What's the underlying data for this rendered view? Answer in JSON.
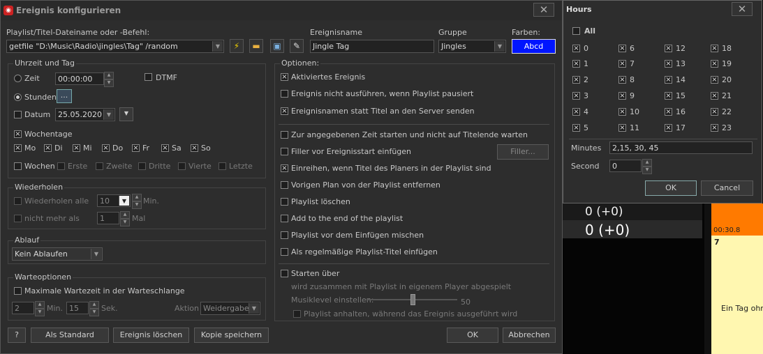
{
  "dialog": {
    "title": "Ereignis konfigurieren",
    "close": "✕",
    "playlist_label": "Playlist/Titel-Dateiname oder -Befehl:",
    "playlist_value": "getfile \"D:\\Music\\Radio\\jingles\\Tag\" /random",
    "eventname_label": "Ereignisname",
    "eventname_value": "Jingle Tag",
    "group_label": "Gruppe",
    "group_value": "Jingles",
    "colors_label": "Farben:",
    "color_value": "Abcd"
  },
  "time": {
    "group_label": "Uhrzeit und Tag",
    "zeit_label": "Zeit",
    "zeit_value": "00:00:00",
    "dtmf_label": "DTMF",
    "stunden_label": "Stunden",
    "stunden_button": "...",
    "datum_label": "Datum",
    "datum_value": "25.05.2020",
    "wochentage_label": "Wochentage",
    "days": [
      "Mo",
      "Di",
      "Mi",
      "Do",
      "Fr",
      "Sa",
      "So"
    ],
    "wochen_label": "Wochen",
    "weeks": [
      "Erste",
      "Zweite",
      "Dritte",
      "Vierte",
      "Letzte"
    ]
  },
  "repeat": {
    "group_label": "Wiederholen",
    "every_label": "Wiederholen alle",
    "every_value": "10",
    "min_label": "Min.",
    "max_label": "nicht mehr als",
    "max_value": "1",
    "mal_label": "Mal"
  },
  "expire": {
    "group_label": "Ablauf",
    "value": "Kein Ablaufen"
  },
  "wait": {
    "group_label": "Warteoptionen",
    "max_label": "Maximale Wartezeit in der Warteschlange",
    "min_value": "2",
    "min_label": "Min.",
    "sec_value": "15",
    "sec_label": "Sek.",
    "action_label": "Aktion",
    "action_value": "Weidergabe"
  },
  "options": {
    "group_label": "Optionen:",
    "items": [
      {
        "label": "Aktiviertes Ereignis",
        "checked": true
      },
      {
        "label": "Ereignis nicht ausführen, wenn Playlist pausiert",
        "checked": false
      },
      {
        "label": "Ereignisnamen statt Titel an den Server senden",
        "checked": true
      },
      {
        "label": "Zur angegebenen Zeit starten und nicht auf Titelende warten",
        "checked": false
      },
      {
        "label": "Filler vor Ereignisstart einfügen",
        "checked": false
      },
      {
        "label": "Einreihen, wenn Titel des Planers in der Playlist sind",
        "checked": true
      },
      {
        "label": "Vorigen Plan von der Playlist entfernen",
        "checked": false
      },
      {
        "label": "Playlist löschen",
        "checked": false
      },
      {
        "label": "Add to the end of the playlist",
        "checked": false
      },
      {
        "label": "Playlist vor dem Einfügen mischen",
        "checked": false
      },
      {
        "label": "Als regelmäßige Playlist-Titel einfügen",
        "checked": false
      },
      {
        "label": "Starten über",
        "checked": false
      }
    ],
    "filler_button": "Filler...",
    "starten_desc": "wird zusammen mit Playlist in eigenem Player abgespielt",
    "musiklevel_label": "Musiklevel einstellen:",
    "musiklevel_value": "50",
    "anhalten_label": "Playlist anhalten, während das Ereignis ausgeführt wird"
  },
  "buttons": {
    "help": "?",
    "standard": "Als Standard",
    "delete": "Ereignis löschen",
    "copy": "Kopie speichern",
    "ok": "OK",
    "cancel": "Abbrechen"
  },
  "hours": {
    "title": "Hours",
    "close": "✕",
    "all_label": "All",
    "cols": [
      [
        "0",
        "1",
        "2",
        "3",
        "4",
        "5"
      ],
      [
        "6",
        "7",
        "8",
        "9",
        "10",
        "11"
      ],
      [
        "12",
        "13",
        "14",
        "15",
        "16",
        "17"
      ],
      [
        "18",
        "19",
        "20",
        "21",
        "22",
        "23"
      ]
    ],
    "minutes_label": "Minutes",
    "minutes_value": "2,15, 30, 45",
    "second_label": "Second",
    "second_value": "0",
    "ok": "OK",
    "cancel": "Cancel"
  },
  "background": {
    "counter1": "0 (+0)",
    "counter2": "0 (+0)",
    "time": "00:30.8",
    "number": "7",
    "caption": "Ein Tag ohne"
  },
  "icons": [
    "app-icon",
    "lightning-icon",
    "folder-icon",
    "window-icon",
    "edit-icon"
  ]
}
